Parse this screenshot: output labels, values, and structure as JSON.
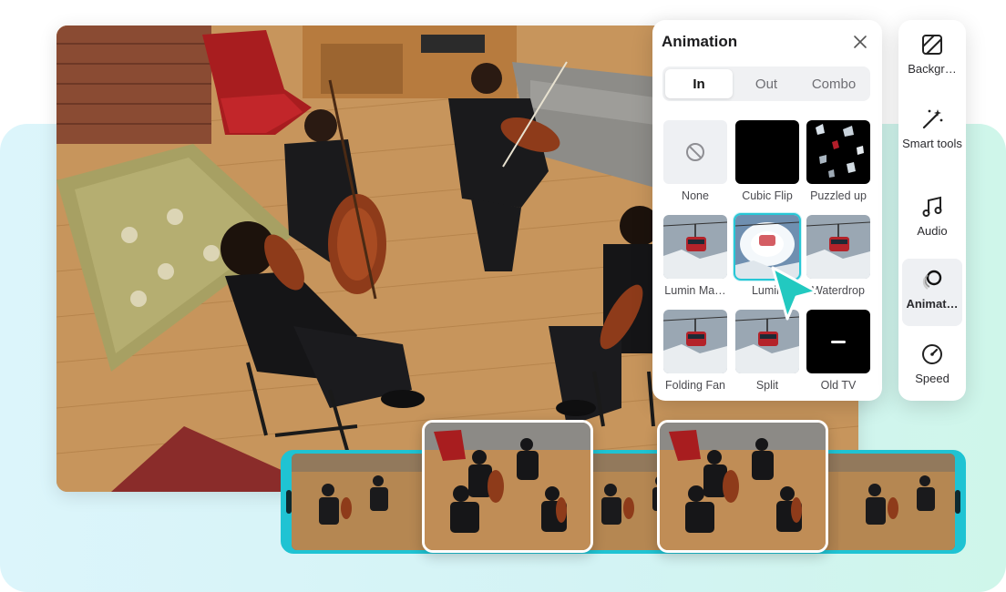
{
  "panel": {
    "title": "Animation",
    "tabs": [
      {
        "label": "In",
        "active": true
      },
      {
        "label": "Out",
        "active": false
      },
      {
        "label": "Combo",
        "active": false
      }
    ],
    "items": [
      {
        "label": "None",
        "thumb": "none-icon"
      },
      {
        "label": "Cubic Flip",
        "thumb": "black"
      },
      {
        "label": "Puzzled up",
        "thumb": "pieces"
      },
      {
        "label": "Lumin Ma…",
        "thumb": "gondola"
      },
      {
        "label": "Lumin",
        "thumb": "gondola-bright",
        "selected": true
      },
      {
        "label": "Waterdrop",
        "thumb": "gondola"
      },
      {
        "label": "Folding Fan",
        "thumb": "gondola"
      },
      {
        "label": "Split",
        "thumb": "gondola"
      },
      {
        "label": "Old TV",
        "thumb": "oldtv"
      }
    ]
  },
  "toolbar": {
    "items": [
      {
        "label": "Backgr…",
        "icon": "background-icon"
      },
      {
        "label": "Smart tools",
        "icon": "magic-wand-icon"
      },
      {
        "label": "Audio",
        "icon": "music-note-icon"
      },
      {
        "label": "Animat…",
        "icon": "animation-icon",
        "active": true
      },
      {
        "label": "Speed",
        "icon": "speedometer-icon"
      }
    ]
  },
  "colors": {
    "accent": "#1fc3d3",
    "selected_outline": "#27c7d6"
  }
}
